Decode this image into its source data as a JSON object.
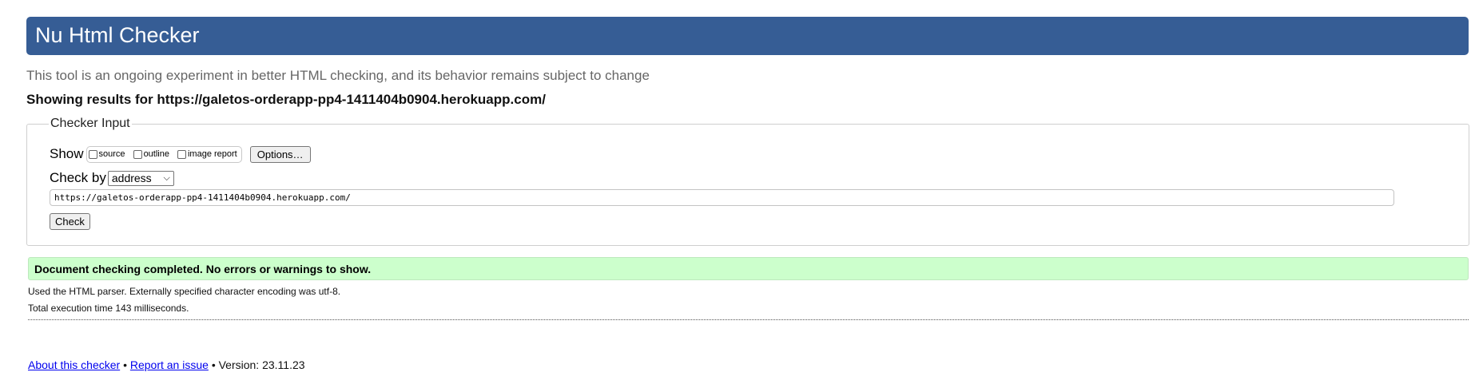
{
  "header": {
    "title": "Nu Html Checker"
  },
  "subtitle": "This tool is an ongoing experiment in better HTML checking, and its behavior remains subject to change",
  "showing_results": "Showing results for https://galetos-orderapp-pp4-1411404b0904.herokuapp.com/",
  "checker_input": {
    "legend": "Checker Input",
    "show_label": "Show",
    "show_options": [
      {
        "label": "source",
        "checked": false
      },
      {
        "label": "outline",
        "checked": false
      },
      {
        "label": "image report",
        "checked": false
      }
    ],
    "options_button": "Options…",
    "check_by_label": "Check by",
    "check_by_value": "address",
    "url_value": "https://galetos-orderapp-pp4-1411404b0904.herokuapp.com/",
    "check_button": "Check"
  },
  "result": {
    "message": "Document checking completed. No errors or warnings to show.",
    "status_color": "#ccffcc",
    "parser_info": "Used the HTML parser. Externally specified character encoding was utf-8.",
    "execution_time": "Total execution time 143 milliseconds."
  },
  "footer": {
    "about_link": "About this checker",
    "separator": "•",
    "report_link": "Report an issue",
    "version": "Version: 23.11.23"
  },
  "colors": {
    "header_bg": "#365d95",
    "header_text": "#ffffff"
  }
}
